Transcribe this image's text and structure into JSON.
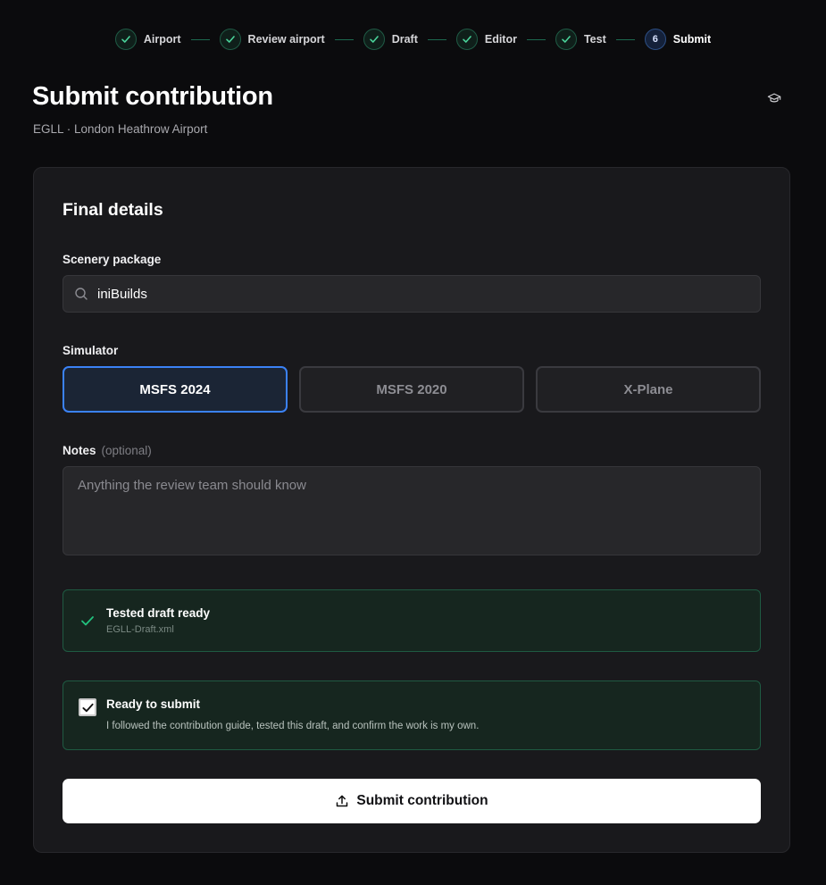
{
  "stepper": {
    "steps": [
      {
        "label": "Airport",
        "state": "done"
      },
      {
        "label": "Review airport",
        "state": "done"
      },
      {
        "label": "Draft",
        "state": "done"
      },
      {
        "label": "Editor",
        "state": "done"
      },
      {
        "label": "Test",
        "state": "done"
      },
      {
        "label": "Submit",
        "state": "current",
        "number": "6"
      }
    ]
  },
  "header": {
    "title": "Submit contribution",
    "subtitle": "EGLL · London Heathrow Airport",
    "guide_icon": "graduation-cap-icon"
  },
  "card": {
    "title": "Final details",
    "package": {
      "label": "Scenery package",
      "value": "iniBuilds",
      "icon": "search-icon"
    },
    "simulator": {
      "label": "Simulator",
      "options": [
        "MSFS 2024",
        "MSFS 2020",
        "X-Plane"
      ],
      "selected": "MSFS 2024"
    },
    "notes": {
      "label": "Notes",
      "optional": "(optional)",
      "placeholder": "Anything the review team should know"
    },
    "draft_status": {
      "title": "Tested draft ready",
      "file": "EGLL-Draft.xml",
      "icon": "check-icon"
    },
    "confirm": {
      "title": "Ready to submit",
      "text": "I followed the contribution guide, tested this draft, and confirm the work is my own.",
      "checked": true
    },
    "submit": {
      "label": "Submit contribution",
      "icon": "upload-icon"
    }
  },
  "colors": {
    "background": "#0b0b0d",
    "card": "#19191c",
    "accent_blue": "#3b82f6",
    "success_green": "#22c37f"
  }
}
